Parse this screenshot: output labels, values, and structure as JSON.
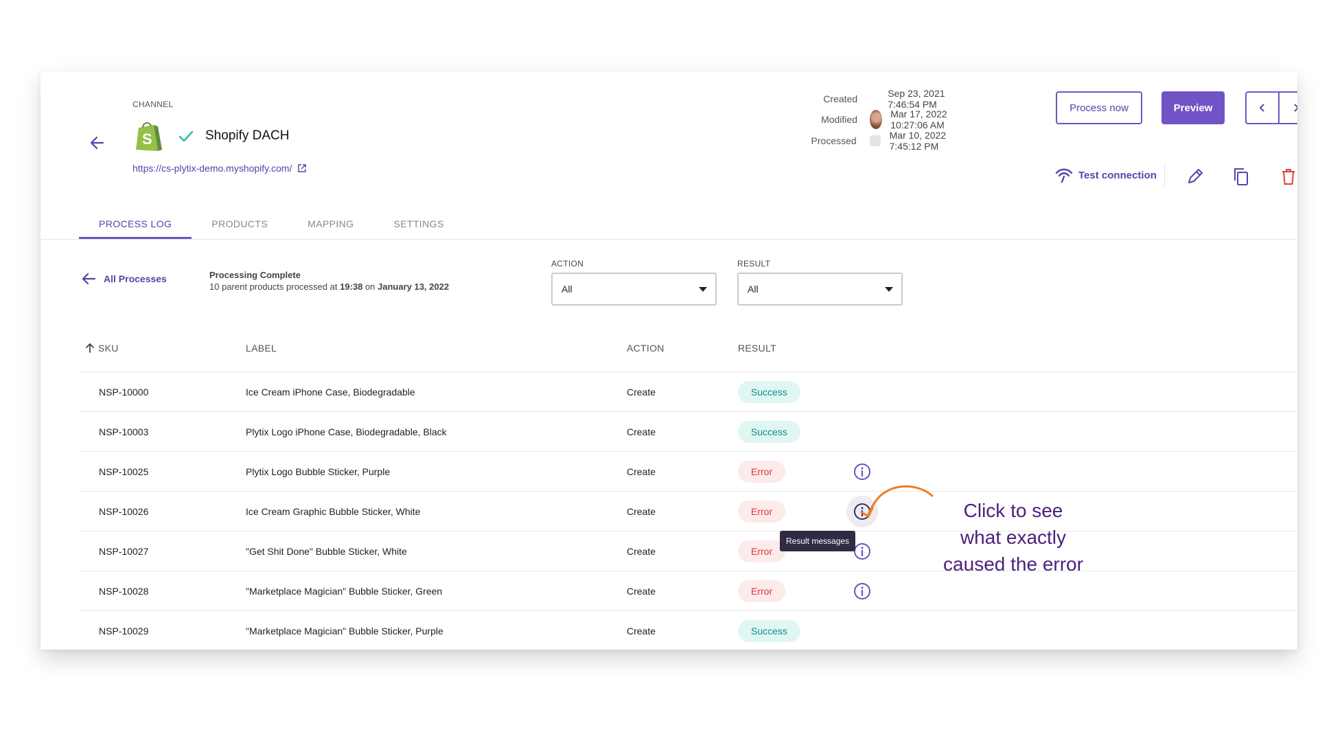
{
  "header": {
    "channel_label": "CHANNEL",
    "channel_name": "Shopify DACH",
    "channel_url": "https://cs-plytix-demo.myshopify.com/",
    "meta": [
      {
        "key": "Created",
        "value": "Sep 23, 2021 7:46:54 PM"
      },
      {
        "key": "Modified",
        "value": "Mar 17, 2022 10:27:06 AM"
      },
      {
        "key": "Processed",
        "value": "Mar 10, 2022 7:45:12 PM"
      }
    ],
    "process_now_label": "Process now",
    "preview_label": "Preview",
    "test_connection_label": "Test connection"
  },
  "tabs": [
    "PROCESS LOG",
    "PRODUCTS",
    "MAPPING",
    "SETTINGS"
  ],
  "filter_bar": {
    "all_processes_label": "All Processes",
    "status_title": "Processing Complete",
    "status_prefix": "10 parent products processed at ",
    "status_time": "19:38",
    "status_on": " on ",
    "status_date": "January 13, 2022",
    "action_label": "ACTION",
    "action_value": "All",
    "result_label": "RESULT",
    "result_value": "All"
  },
  "table": {
    "columns": [
      "SKU",
      "LABEL",
      "ACTION",
      "RESULT"
    ],
    "rows": [
      {
        "sku": "NSP-10000",
        "label": "Ice Cream iPhone Case, Biodegradable",
        "action": "Create",
        "result": "Success"
      },
      {
        "sku": "NSP-10003",
        "label": "Plytix Logo iPhone Case, Biodegradable, Black",
        "action": "Create",
        "result": "Success"
      },
      {
        "sku": "NSP-10025",
        "label": "Plytix Logo Bubble Sticker, Purple",
        "action": "Create",
        "result": "Error"
      },
      {
        "sku": "NSP-10026",
        "label": "Ice Cream Graphic Bubble Sticker, White",
        "action": "Create",
        "result": "Error"
      },
      {
        "sku": "NSP-10027",
        "label": "\"Get Shit Done\" Bubble Sticker, White",
        "action": "Create",
        "result": "Error"
      },
      {
        "sku": "NSP-10028",
        "label": "\"Marketplace Magician\" Bubble Sticker, Green",
        "action": "Create",
        "result": "Error"
      },
      {
        "sku": "NSP-10029",
        "label": "\"Marketplace Magician\" Bubble Sticker, Purple",
        "action": "Create",
        "result": "Success"
      }
    ]
  },
  "tooltip": "Result messages",
  "annotation": {
    "line1": "Click to see",
    "line2": "what exactly",
    "line3": "caused the error",
    "color": "#4b1f7a",
    "arrow_color": "#ef7b22"
  },
  "colors": {
    "accent": "#7153c6",
    "success_bg": "#e0f6f3",
    "success_text": "#0e8f80",
    "error_bg": "#fdeaea",
    "error_text": "#d6383a",
    "shopify_green": "#95bf47"
  },
  "icons": [
    "arrow-left-icon",
    "shopify-logo-icon",
    "check-icon",
    "external-link-icon",
    "chevron-left-icon",
    "chevron-right-icon",
    "wifi-signal-icon",
    "pencil-icon",
    "copy-icon",
    "trash-icon",
    "sort-up-icon",
    "info-circle-icon"
  ]
}
